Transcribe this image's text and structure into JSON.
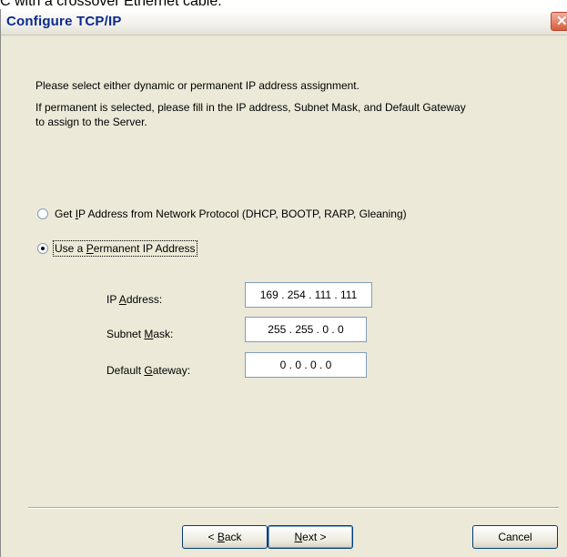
{
  "doc_snippet": "C with a crossover Ethernet cable.",
  "window": {
    "title": "Configure TCP/IP",
    "close_glyph": "✕"
  },
  "intro": {
    "line1": "Please select either dynamic or permanent IP address assignment.",
    "line2a": "If permanent is selected, please fill in the IP address, Subnet Mask, and Default Gateway",
    "line2b": "to assign to the Server."
  },
  "options": {
    "dhcp": {
      "label_pre": "Get ",
      "label_key": "I",
      "label_post": "P Address from Network Protocol (DHCP, BOOTP, RARP, Gleaning)",
      "checked": false
    },
    "permanent": {
      "label_pre": "Use a ",
      "label_key": "P",
      "label_post": "ermanent IP Address",
      "checked": true
    }
  },
  "fields": {
    "ip": {
      "label_pre": "IP ",
      "label_key": "A",
      "label_post": "ddress:",
      "value": "169 . 254 . 111 . 111"
    },
    "subnet": {
      "label_pre": "Subnet ",
      "label_key": "M",
      "label_post": "ask:",
      "value": "255 . 255 .   0   .   0"
    },
    "gateway": {
      "label_pre": "Default ",
      "label_key": "G",
      "label_post": "ateway:",
      "value": "0   .   0   .   0   .   0"
    }
  },
  "buttons": {
    "back": {
      "pre": "< ",
      "key": "B",
      "post": "ack"
    },
    "next": {
      "pre": "",
      "key": "N",
      "post": "ext >"
    },
    "cancel": {
      "label": "Cancel"
    }
  },
  "colors": {
    "dialog_bg": "#ece9d8",
    "title_text": "#0b2a8a",
    "close_button": "#d85c3c",
    "field_border": "#7f9db9"
  }
}
